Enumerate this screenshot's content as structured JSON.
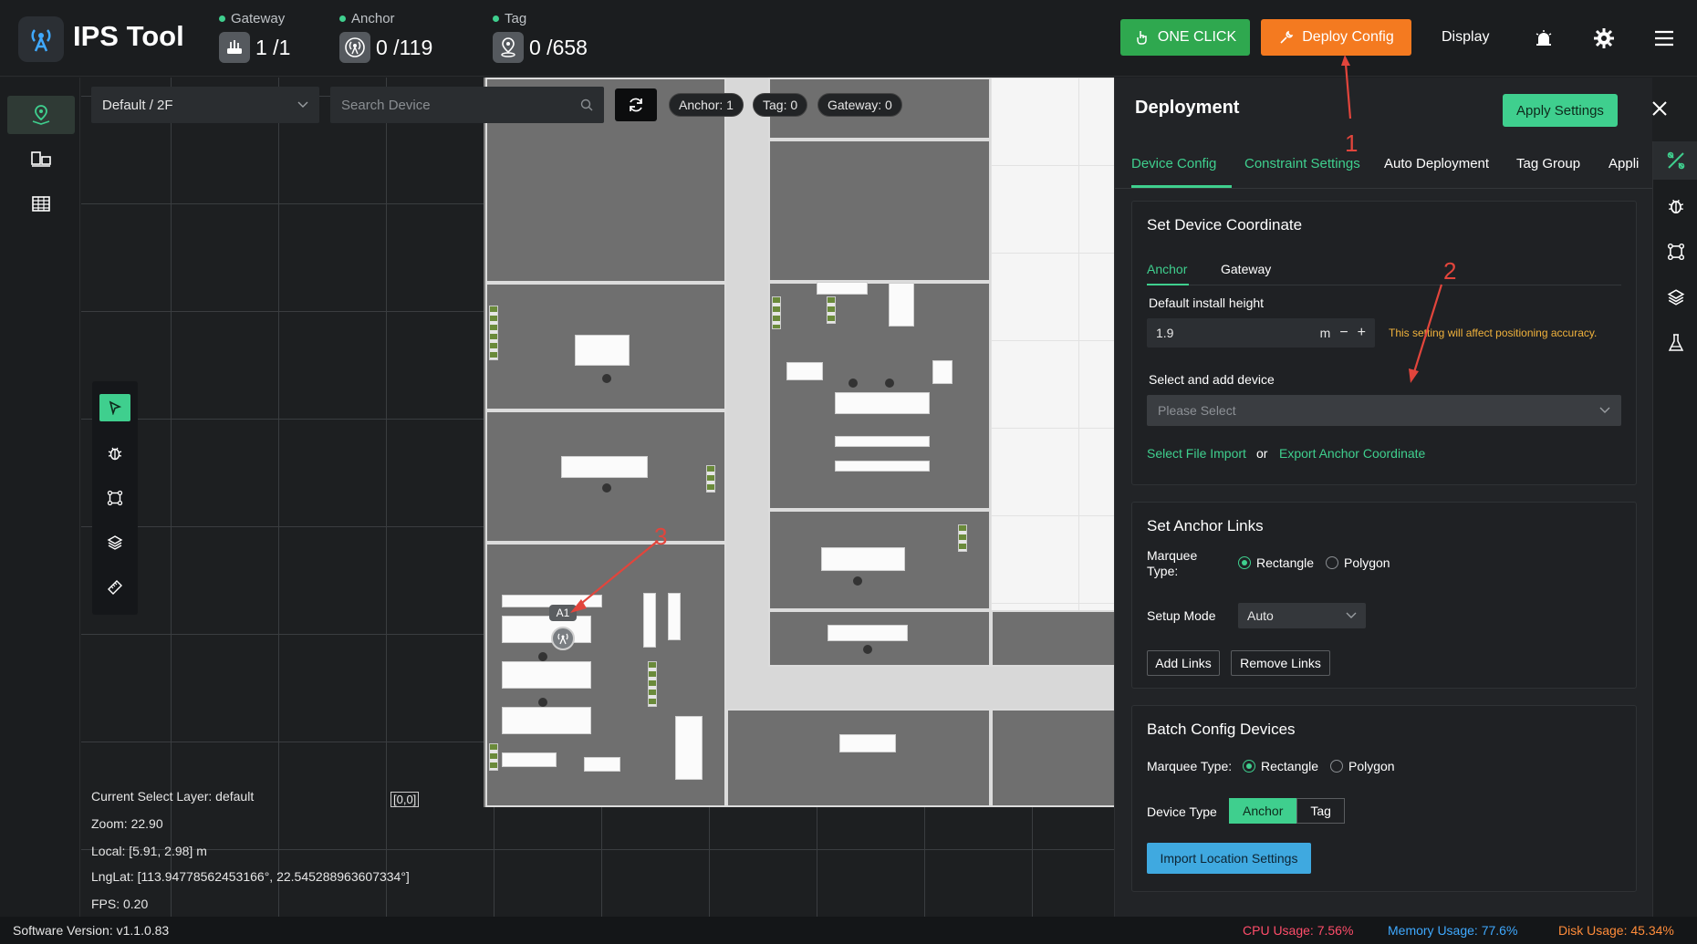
{
  "header": {
    "app_title": "IPS Tool",
    "gateway_label": "Gateway",
    "gateway_value": "1 /1",
    "anchor_label": "Anchor",
    "anchor_value": "0 /119",
    "tag_label": "Tag",
    "tag_value": "0 /658",
    "one_click_label": "ONE CLICK",
    "deploy_config_label": "Deploy Config",
    "display_label": "Display",
    "accent_green": "#2fa84f",
    "accent_orange": "#f47a20"
  },
  "map": {
    "floor_select": "Default / 2F",
    "search_placeholder": "Search Device",
    "pill_anchor": "Anchor: 1",
    "pill_tag": "Tag: 0",
    "pill_gateway": "Gateway: 0",
    "anchor_marker_label": "A1",
    "origin_label": "[0,0]",
    "info": {
      "layer": "Current Select Layer:  default",
      "zoom": "Zoom:  22.90",
      "local": "Local:  [5.91, 2.98] m",
      "lnglat": "LngLat:  [113.94778562453166°, 22.545288963607334°]",
      "fps": "FPS:  0.20"
    }
  },
  "drawer": {
    "title": "Deployment",
    "apply_label": "Apply Settings",
    "tabs": [
      "Device Config",
      "Constraint Settings",
      "Auto Deployment",
      "Tag Group",
      "Appli"
    ],
    "coord_card": {
      "title": "Set Device Coordinate",
      "sub_tabs": [
        "Anchor",
        "Gateway"
      ],
      "height_label": "Default install height",
      "height_value": "1.9",
      "height_unit": "m",
      "warning": "This setting will affect positioning accuracy.",
      "select_label": "Select and add device",
      "select_placeholder": "Please Select",
      "file_import": "Select File Import",
      "or_text": "or",
      "export_link": "Export Anchor Coordinate"
    },
    "links_card": {
      "title": "Set Anchor Links",
      "marquee_label_1": "Marquee",
      "marquee_label_2": "Type:",
      "rect_label": "Rectangle",
      "poly_label": "Polygon",
      "setup_mode_label": "Setup Mode",
      "setup_mode_value": "Auto",
      "add_links": "Add Links",
      "remove_links": "Remove Links"
    },
    "batch_card": {
      "title": "Batch Config Devices",
      "marquee_label": "Marquee Type:",
      "rect_label": "Rectangle",
      "poly_label": "Polygon",
      "device_type_label": "Device Type",
      "type_anchor": "Anchor",
      "type_tag": "Tag",
      "import_btn": "Import Location Settings"
    }
  },
  "annotations": [
    "1",
    "2",
    "3"
  ],
  "status": {
    "version": "Software Version:  v1.1.0.83",
    "cpu": "CPU Usage:  7.56%",
    "memory": "Memory Usage:  77.6%",
    "disk": "Disk Usage:  45.34%",
    "cpu_color": "#ff4d6a",
    "memory_color": "#3fa9ff",
    "disk_color": "#ff8c3a"
  }
}
